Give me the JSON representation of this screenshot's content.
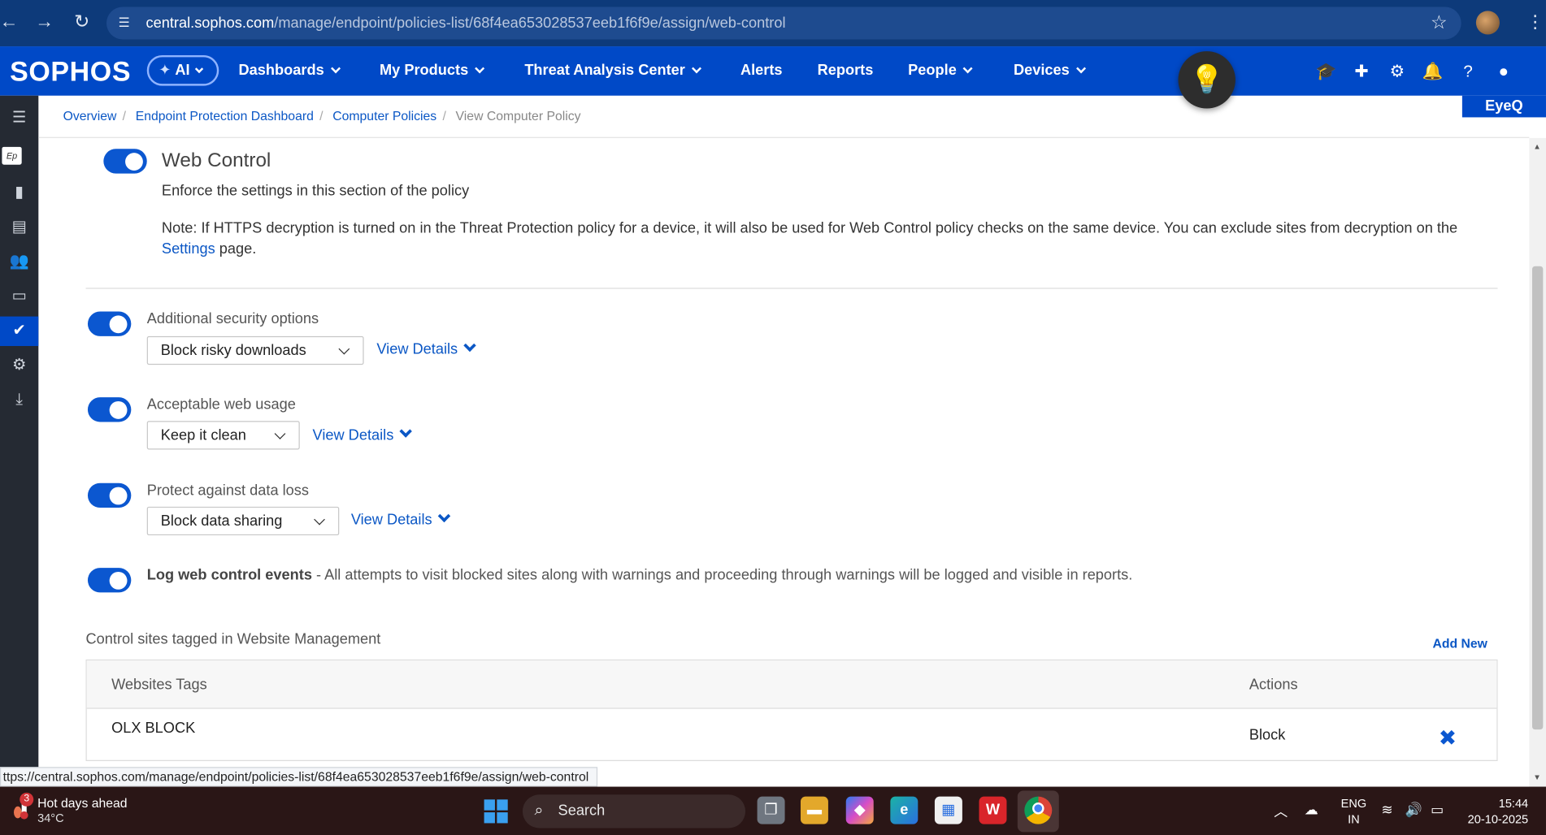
{
  "browser": {
    "url_host": "central.sophos.com",
    "url_path": "/manage/endpoint/policies-list/68f4ea653028537eeb1f6f9e/assign/web-control",
    "status_url": "ttps://central.sophos.com/manage/endpoint/policies-list/68f4ea653028537eeb1f6f9e/assign/web-control"
  },
  "header": {
    "logo": "SOPHOS",
    "ai_label": "AI",
    "nav": [
      "Dashboards",
      "My Products",
      "Threat Analysis Center",
      "Alerts",
      "Reports",
      "People",
      "Devices"
    ],
    "eyeq_label": "EyeQ"
  },
  "breadcrumb": {
    "items": [
      "Overview",
      "Endpoint Protection Dashboard",
      "Computer Policies"
    ],
    "current": "View Computer Policy"
  },
  "web_control": {
    "title": "Web Control",
    "description": "Enforce the settings in this section of the policy",
    "note_text": "Note: If HTTPS decryption is turned on in the Threat Protection policy for a device, it will also be used for Web Control policy checks on the same device. You can exclude sites from decryption on the",
    "note_link": "Settings",
    "note_tail": " page.",
    "enabled": true
  },
  "options": [
    {
      "label": "Additional security options",
      "value": "Block risky downloads",
      "details": "View Details",
      "enabled": true
    },
    {
      "label": "Acceptable web usage",
      "value": "Keep it clean",
      "details": "View Details",
      "enabled": true
    },
    {
      "label": "Protect against data loss",
      "value": "Block data sharing",
      "details": "View Details",
      "enabled": true
    }
  ],
  "log": {
    "label": "Log web control events",
    "text": " - All attempts to visit blocked sites along with warnings and proceeding through warnings will be logged and visible in reports.",
    "enabled": true
  },
  "website_mgmt": {
    "title": "Control sites tagged in Website Management",
    "add_new": "Add New",
    "columns": [
      "Websites Tags",
      "Actions"
    ],
    "rows": [
      {
        "tag": "OLX BLOCK",
        "action": "Block"
      }
    ]
  },
  "taskbar": {
    "weather_title": "Hot days ahead",
    "weather_temp": "34°C",
    "weather_badge": "3",
    "search_placeholder": "Search",
    "lang_top": "ENG",
    "lang_bottom": "IN",
    "time": "15:44",
    "date": "20-10-2025"
  },
  "colors": {
    "brand": "#0049c7",
    "toggle_on": "#0b57d0",
    "link": "#0b57c5"
  }
}
